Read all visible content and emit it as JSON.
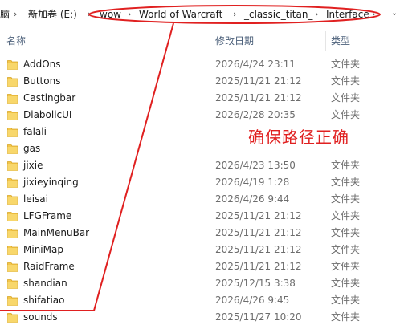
{
  "breadcrumb": {
    "items": [
      "脑",
      "新加卷 (E:)",
      "wow",
      "World of Warcraft",
      "_classic_titan_",
      "Interface"
    ],
    "separator": "›"
  },
  "columns": {
    "name": "名称",
    "date": "修改日期",
    "type": "类型"
  },
  "files": [
    {
      "name": "AddOns",
      "date": "2026/4/24 23:11",
      "type": "文件夹"
    },
    {
      "name": "Buttons",
      "date": "2025/11/21 21:12",
      "type": "文件夹"
    },
    {
      "name": "Castingbar",
      "date": "2025/11/21 21:12",
      "type": "文件夹"
    },
    {
      "name": "DiabolicUI",
      "date": "2026/2/28 20:35",
      "type": "文件夹"
    },
    {
      "name": "falali",
      "date": "",
      "type": ""
    },
    {
      "name": "gas",
      "date": "",
      "type": ""
    },
    {
      "name": "jixie",
      "date": "2026/4/23 13:50",
      "type": "文件夹"
    },
    {
      "name": "jixieyinqing",
      "date": "2026/4/19 1:28",
      "type": "文件夹"
    },
    {
      "name": "leisai",
      "date": "2026/4/26 9:44",
      "type": "文件夹"
    },
    {
      "name": "LFGFrame",
      "date": "2025/11/21 21:12",
      "type": "文件夹"
    },
    {
      "name": "MainMenuBar",
      "date": "2025/11/21 21:12",
      "type": "文件夹"
    },
    {
      "name": "MiniMap",
      "date": "2025/11/21 21:12",
      "type": "文件夹"
    },
    {
      "name": "RaidFrame",
      "date": "2025/11/21 21:12",
      "type": "文件夹"
    },
    {
      "name": "shandian",
      "date": "2025/12/15 3:38",
      "type": "文件夹"
    },
    {
      "name": "shifatiao",
      "date": "2026/4/26 9:45",
      "type": "文件夹"
    },
    {
      "name": "sounds",
      "date": "2025/11/27 10:20",
      "type": "文件夹"
    }
  ],
  "annotation": {
    "text": "确保路径正确",
    "color": "#e02020"
  },
  "colors": {
    "folder": "#f3c64a",
    "header_text": "#4c607a"
  }
}
